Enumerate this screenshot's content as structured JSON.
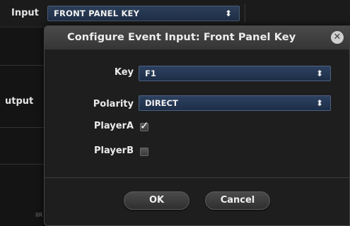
{
  "background": {
    "input_label": "Input",
    "input_value": "FRONT PANEL KEY",
    "output_label": "utput",
    "small_text": "IIR"
  },
  "dialog": {
    "title": "Configure Event Input: Front Panel Key",
    "close_icon": "close-icon",
    "fields": {
      "key_label": "Key",
      "key_value": "F1",
      "polarity_label": "Polarity",
      "polarity_value": "DIRECT",
      "playera_label": "PlayerA",
      "playera_checked": true,
      "playerb_label": "PlayerB",
      "playerb_checked": false
    },
    "buttons": {
      "ok_label": "OK",
      "cancel_label": "Cancel"
    }
  },
  "icons": {
    "select_arrows": "⬍",
    "close": "✕",
    "check": "✓"
  },
  "colors": {
    "select_bg": "#2d4160",
    "dialog_bg": "#1e1e1e",
    "header_bg": "#404040",
    "text": "#ebebeb"
  }
}
